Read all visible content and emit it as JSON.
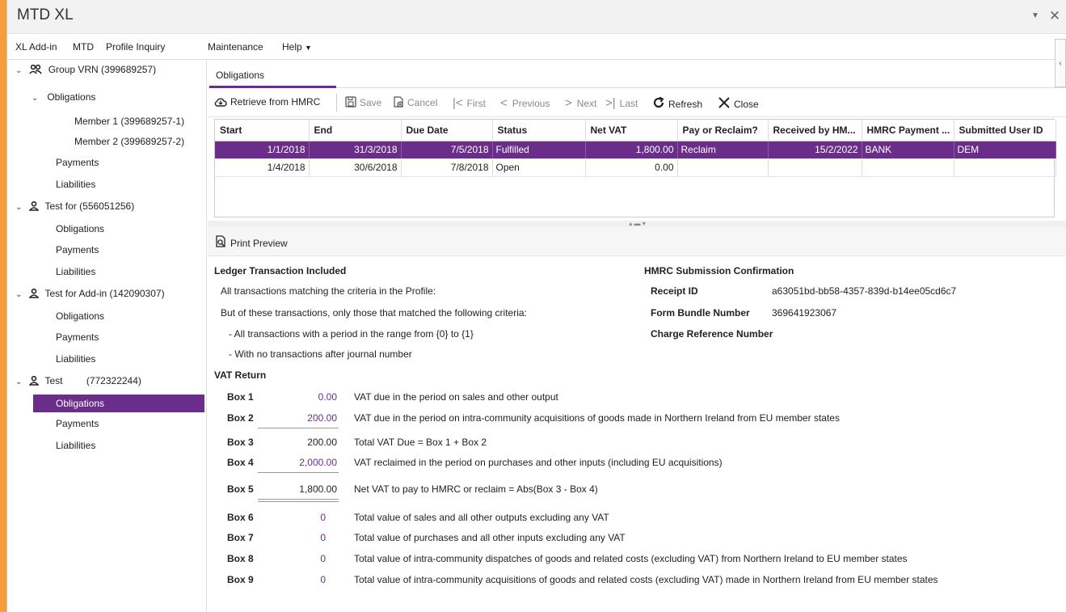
{
  "window": {
    "title": "MTD XL"
  },
  "menu": [
    {
      "label": "XL Add-in"
    },
    {
      "label": "MTD"
    },
    {
      "label": "Profile Inquiry"
    },
    {
      "label": "Maintenance"
    },
    {
      "label": "Help"
    }
  ],
  "tree": {
    "group_label": "Group VRN (399689257)",
    "obligations_label": "Obligations",
    "member1": "Member 1 (399689257-1)",
    "member2": "Member 2 (399689257-2)",
    "payments": "Payments",
    "liabilities": "Liabilities",
    "test1_label": "Test for (556051256)",
    "test2_label": "Test for Add-in (142090307)",
    "test3_name": "Test",
    "test3_vrn": "(772322244)"
  },
  "tab": {
    "label": "Obligations"
  },
  "toolbar": {
    "retrieve": "Retrieve from HMRC",
    "save": "Save",
    "cancel": "Cancel",
    "first": "First",
    "previous": "Previous",
    "next": "Next",
    "last": "Last",
    "refresh": "Refresh",
    "close": "Close"
  },
  "grid": {
    "columns": [
      "Start",
      "End",
      "Due Date",
      "Status",
      "Net VAT",
      "Pay or Reclaim?",
      "Received by HM...",
      "HMRC Payment ...",
      "Submitted User ID"
    ],
    "rows": [
      [
        "1/1/2018",
        "31/3/2018",
        "7/5/2018",
        "Fulfilled",
        "1,800.00",
        "Reclaim",
        "15/2/2022",
        "BANK",
        "DEM"
      ],
      [
        "1/4/2018",
        "30/6/2018",
        "7/8/2018",
        "Open",
        "0.00",
        "",
        "",
        "",
        ""
      ]
    ]
  },
  "print_preview": {
    "label": "Print Preview"
  },
  "ledger": {
    "heading": "Ledger Transaction Included",
    "line1": "All transactions matching the criteria in the Profile:",
    "line2": "But of these transactions, only those that matched the following criteria:",
    "line3": "- All transactions with a period in the range from {0} to {1}",
    "line4": "- With no transactions after journal number"
  },
  "hmrc": {
    "heading": "HMRC Submission Confirmation",
    "receipt_label": "Receipt ID",
    "receipt_value": "a63051bd-bb58-4357-839d-b14ee05cd6c7",
    "bundle_label": "Form Bundle Number",
    "bundle_value": "369641923067",
    "charge_label": "Charge Reference Number"
  },
  "vat": {
    "heading": "VAT Return",
    "boxes": [
      {
        "box": "Box 1",
        "value": "0.00",
        "desc": "VAT due in the period on sales and other output"
      },
      {
        "box": "Box 2",
        "value": "200.00",
        "desc": "VAT due in the period on intra-community acquisitions of goods made in Northern Ireland from EU member states"
      },
      {
        "box": "Box 3",
        "value": "200.00",
        "desc": "Total VAT Due = Box 1 + Box 2"
      },
      {
        "box": "Box 4",
        "value": "2,000.00",
        "desc": "VAT reclaimed in the period on purchases and other inputs (including EU acquisitions)"
      },
      {
        "box": "Box 5",
        "value": "1,800.00",
        "desc": "Net VAT to pay to HMRC or reclaim = Abs(Box 3 - Box 4)"
      },
      {
        "box": "Box 6",
        "value": "0",
        "desc": "Total value of sales and all other outputs excluding any VAT"
      },
      {
        "box": "Box 7",
        "value": "0",
        "desc": "Total value of purchases and all other inputs excluding any VAT"
      },
      {
        "box": "Box 8",
        "value": "0",
        "desc": "Total value of intra-community dispatches of goods and related costs (excluding VAT) from Northern Ireland to EU member states"
      },
      {
        "box": "Box 9",
        "value": "0",
        "desc": "Total value of intra-community acquisitions of goods and related costs (excluding VAT) made in Northern Ireland from EU member states"
      }
    ]
  },
  "colors": {
    "accent": "#6a2e8a",
    "frame": "#f3a03a"
  }
}
